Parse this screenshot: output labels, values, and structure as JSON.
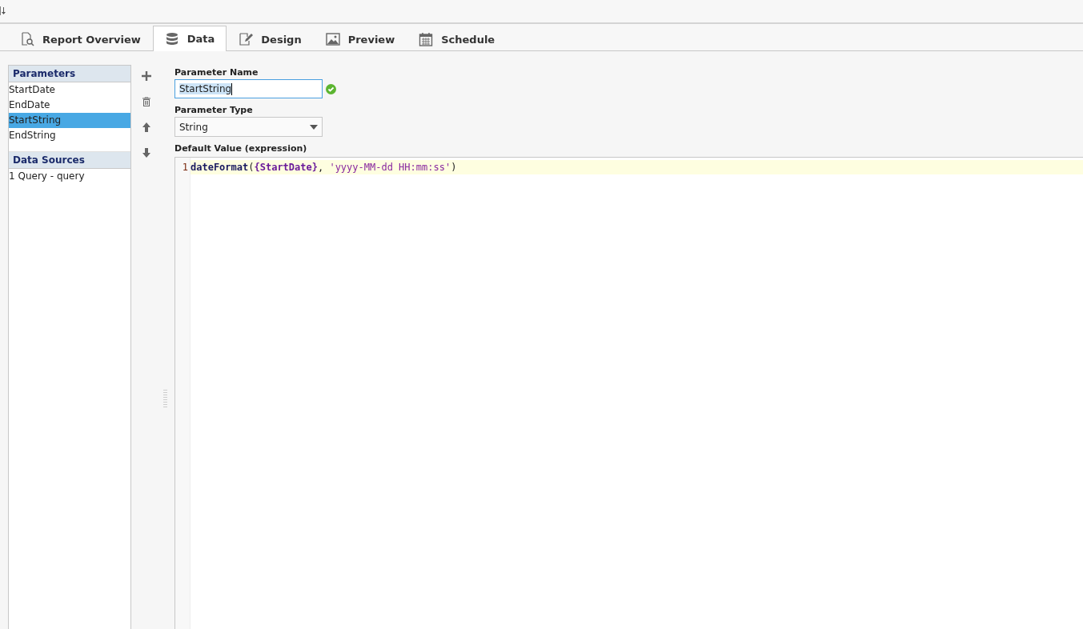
{
  "tabs": [
    {
      "label": "Report Overview",
      "kind": "report",
      "selected": false
    },
    {
      "label": "Data",
      "kind": "database",
      "selected": true
    },
    {
      "label": "Design",
      "kind": "design",
      "selected": false
    },
    {
      "label": "Preview",
      "kind": "image",
      "selected": false
    },
    {
      "label": "Schedule",
      "kind": "calendar",
      "selected": false
    }
  ],
  "parameters": {
    "title": "Parameters",
    "items": [
      {
        "label": "StartDate",
        "selected": false
      },
      {
        "label": "EndDate",
        "selected": false
      },
      {
        "label": "StartString",
        "selected": true
      },
      {
        "label": "EndString",
        "selected": false
      }
    ]
  },
  "data_sources": {
    "title": "Data Sources",
    "items": [
      {
        "label": "1 Query - query",
        "selected": false
      }
    ]
  },
  "toolbar": [
    {
      "kind": "add"
    },
    {
      "kind": "delete"
    },
    {
      "kind": "up"
    },
    {
      "kind": "down"
    }
  ],
  "parameter_name": {
    "label": "Parameter Name",
    "value": "StartString",
    "valid": true
  },
  "parameter_type": {
    "label": "Parameter Type",
    "value": "String"
  },
  "default_value": {
    "label": "Default Value (expression)",
    "lines": [
      {
        "number": "1",
        "tokens": [
          {
            "kind": "function",
            "text": "dateFormat"
          },
          {
            "kind": "punct",
            "text": "("
          },
          {
            "kind": "reference",
            "text": "{StartDate}"
          },
          {
            "kind": "punct",
            "text": ", "
          },
          {
            "kind": "string",
            "text": "'yyyy-MM-dd HH:mm:ss'"
          },
          {
            "kind": "punct",
            "text": ")"
          }
        ]
      }
    ]
  }
}
